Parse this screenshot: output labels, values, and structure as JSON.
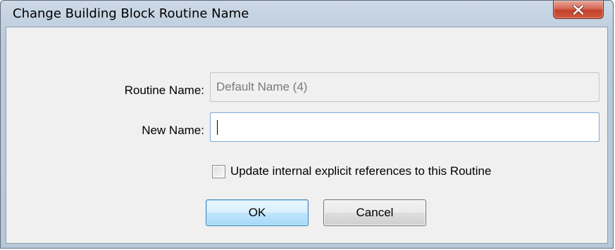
{
  "window": {
    "title": "Change Building Block Routine Name"
  },
  "title_bar": {
    "close_icon": "close-x-icon"
  },
  "form": {
    "routine_name_label": "Routine Name:",
    "routine_name_value": "Default Name (4)",
    "new_name_label": "New Name:",
    "new_name_value": "",
    "update_references_label": "Update internal explicit references to this Routine",
    "update_references_checked": false
  },
  "buttons": {
    "ok_label": "OK",
    "cancel_label": "Cancel"
  },
  "colors": {
    "close_button": "#c2412a",
    "default_button_border": "#3c7fb1",
    "focus_border": "#7fa9d7"
  }
}
